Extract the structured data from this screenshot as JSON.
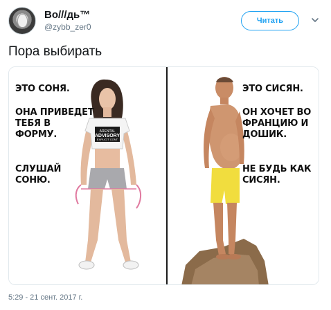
{
  "user": {
    "display_name": "Bo///дь™",
    "handle": "@zybb_zer0"
  },
  "follow_button": {
    "label": "Читать"
  },
  "tweet": {
    "text": "Пора выбирать",
    "timestamp": "5:29 - 21 сент. 2017 г."
  },
  "meme": {
    "left_panel": {
      "line1": "ЭТО СОНЯ.",
      "line2": "ОНА ПРИВЕДЕТ\nТЕБЯ В\nФОРМУ.",
      "line3": "СЛУШАЙ\nСОНЮ.",
      "shirt_text": "ARENTAL\nADVISORY\nEXPLICIT CONT"
    },
    "right_panel": {
      "line1": "ЭТО СИСЯН.",
      "line2": "ОН ХОЧЕТ ВО\nФРАНЦИЮ И\nДОШИК.",
      "line3": "НЕ БУДЬ КАК\nСИСЯН."
    }
  },
  "colors": {
    "accent": "#1da1f2",
    "secondary_text": "#657786",
    "primary_text": "#14171a"
  },
  "icons": {
    "avatar": "avatar-image",
    "more": "chevron-down-icon"
  }
}
